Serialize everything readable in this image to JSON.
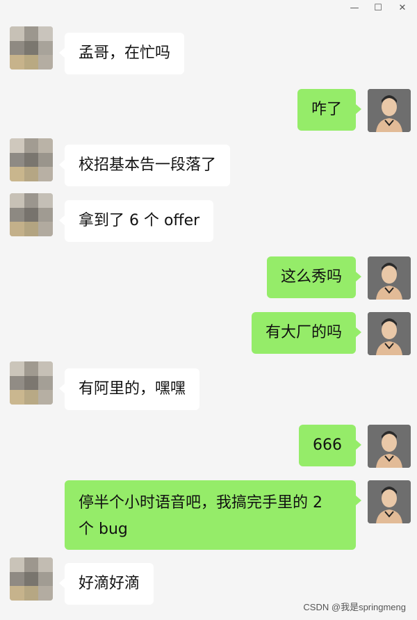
{
  "window": {
    "controls": {
      "minimize": "—",
      "maximize": "☐",
      "close": "✕"
    }
  },
  "messages": [
    {
      "from": "other",
      "text": "孟哥，在忙吗"
    },
    {
      "from": "me",
      "text": "咋了"
    },
    {
      "from": "other",
      "text": "校招基本告一段落了"
    },
    {
      "from": "other",
      "text": "拿到了 6 个 offer"
    },
    {
      "from": "me",
      "text": "这么秀吗"
    },
    {
      "from": "me",
      "text": "有大厂的吗"
    },
    {
      "from": "other",
      "text": "有阿里的，嘿嘿"
    },
    {
      "from": "me",
      "text": "666"
    },
    {
      "from": "me",
      "text": "停半个小时语音吧，我搞完手里的 2 个 bug"
    },
    {
      "from": "other",
      "text": "好滴好滴"
    }
  ],
  "watermark": "CSDN @我是springmeng",
  "colors": {
    "incoming_bubble": "#ffffff",
    "outgoing_bubble": "#95ec69",
    "background": "#f5f5f5"
  },
  "icons": {
    "other_avatar": "pixelated-avatar-icon",
    "my_avatar": "cartoon-man-avatar-icon"
  }
}
